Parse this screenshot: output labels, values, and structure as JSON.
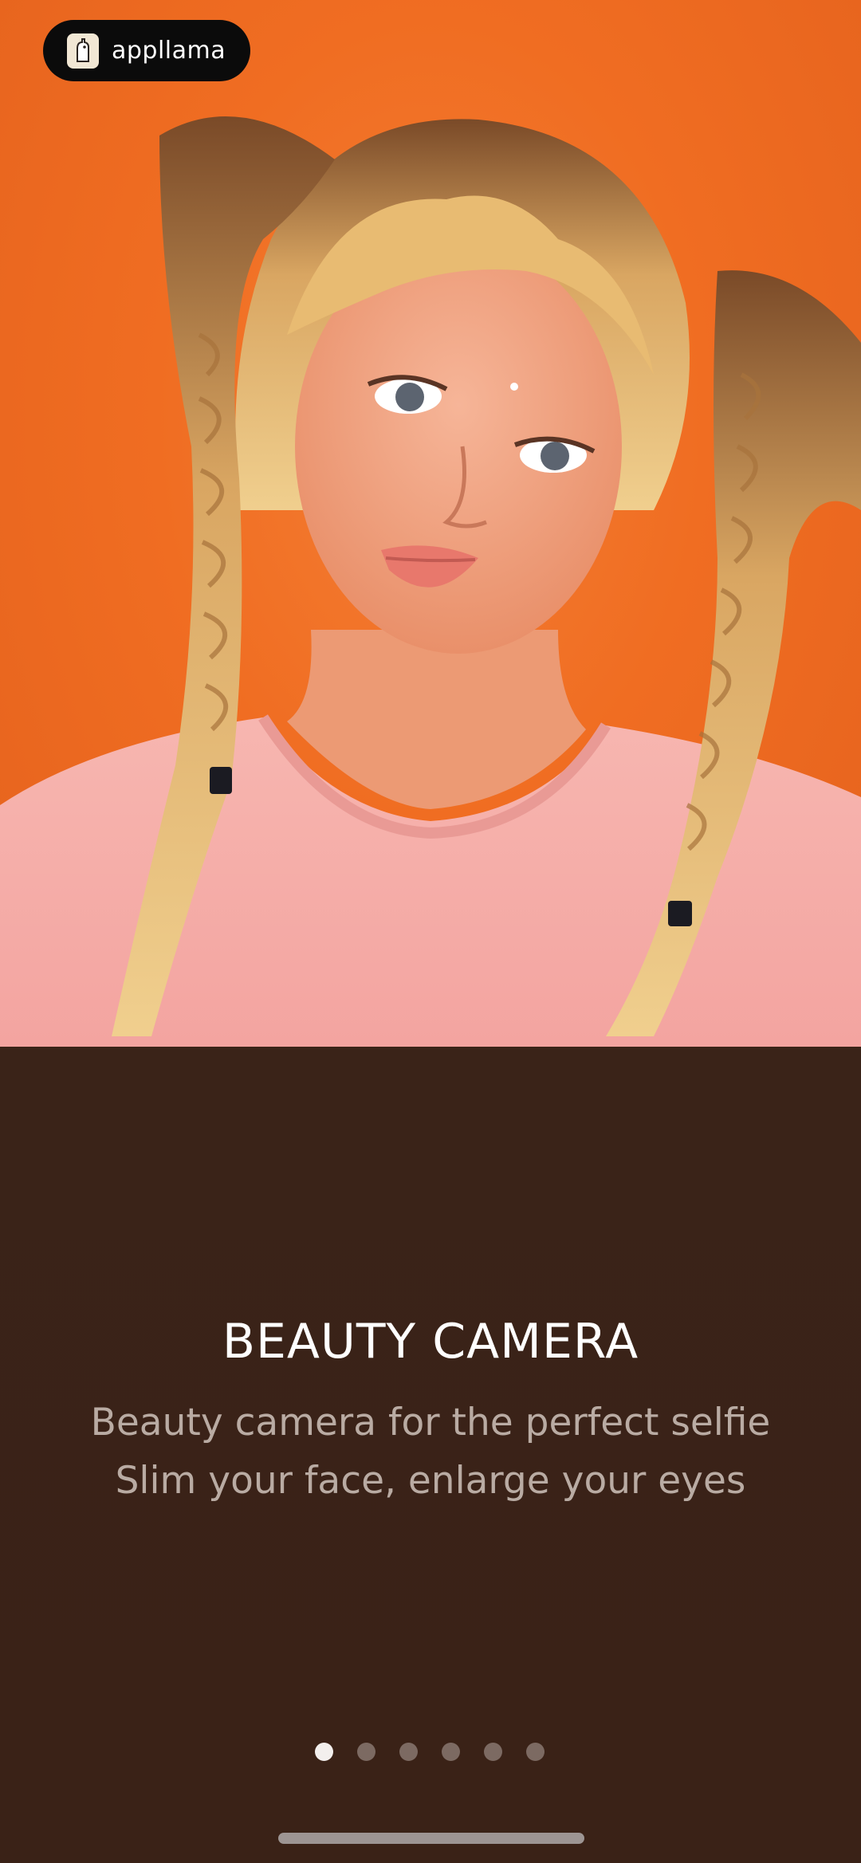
{
  "brand": {
    "name": "appllama",
    "logo_icon": "llama-icon"
  },
  "hero": {
    "image_icon": "portrait-photo"
  },
  "content": {
    "title": "BEAUTY CAMERA",
    "subtitle_line1": "Beauty camera for the perfect selfie",
    "subtitle_line2": "Slim your face, enlarge your eyes"
  },
  "pager": {
    "total": 6,
    "active_index": 0
  },
  "colors": {
    "accent_orange": "#f06d22",
    "panel_brown": "#3a2218",
    "dot_active": "#f3efed",
    "dot_inactive": "#7c6a62"
  }
}
